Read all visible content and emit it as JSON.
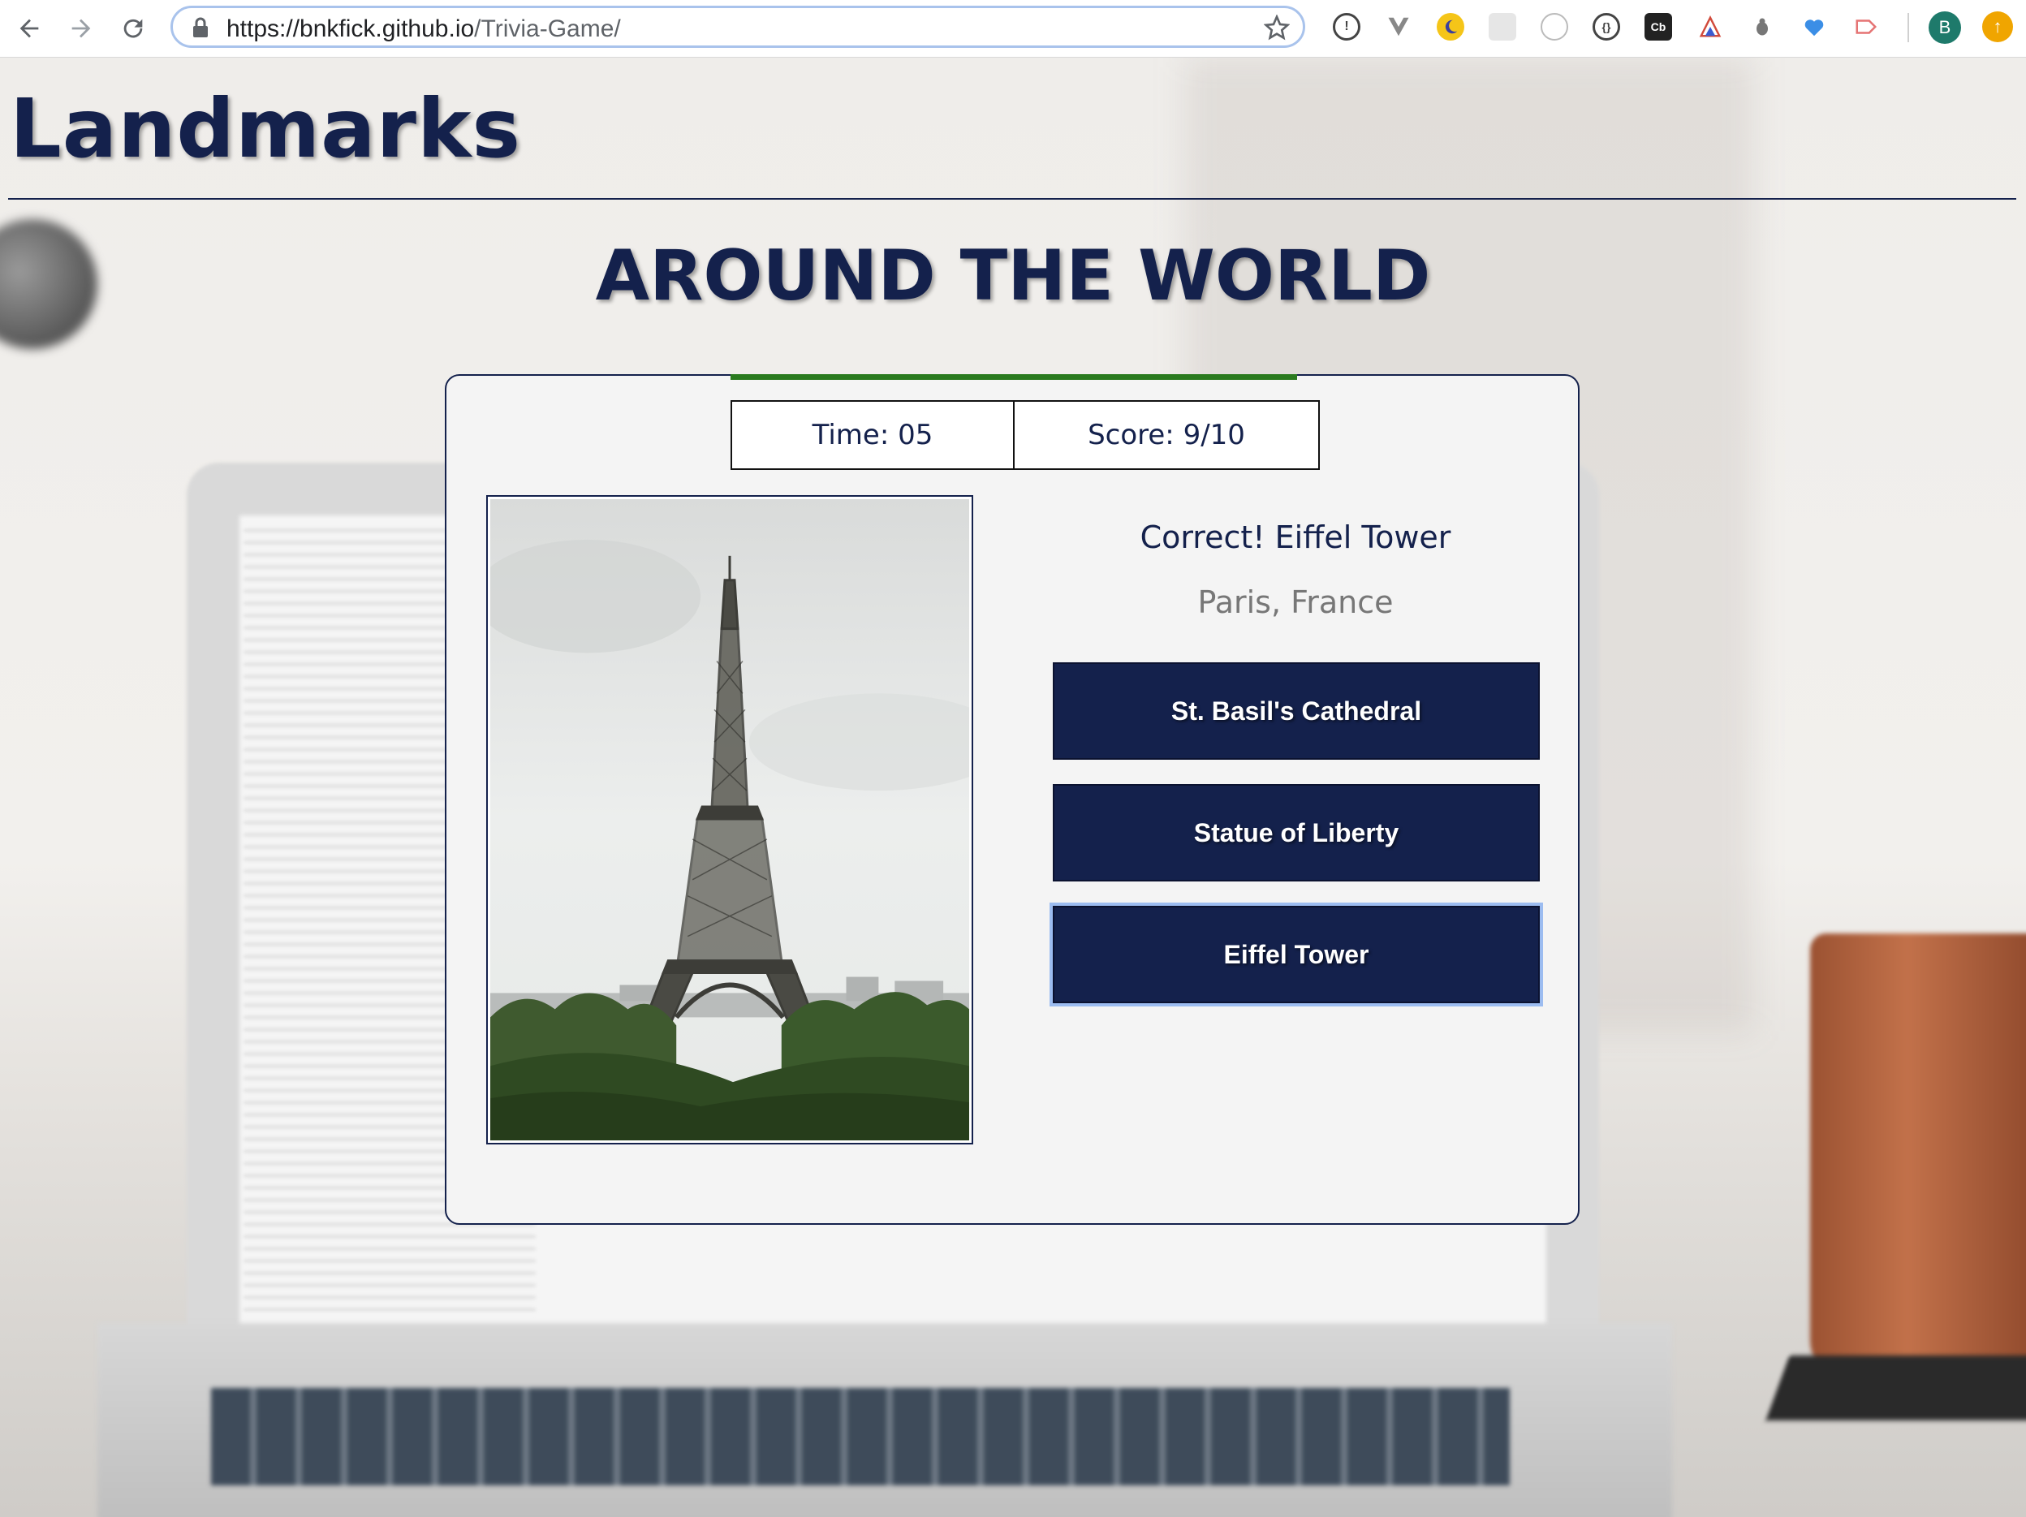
{
  "browser": {
    "url_domain": "https://bnkfick.github.io",
    "url_path": "/Trivia-Game/",
    "avatar_letter": "B"
  },
  "page": {
    "site_title": "Landmarks",
    "subtitle": "AROUND THE WORLD"
  },
  "game": {
    "time_label": "Time: 05",
    "score_label": "Score: 9/10",
    "progress_fraction": 1.0,
    "result_text": "Correct! Eiffel Tower",
    "location_text": "Paris, France",
    "image_subject": "eiffel-tower-photo",
    "answers": [
      {
        "label": "St. Basil's Cathedral"
      },
      {
        "label": "Statue of Liberty"
      },
      {
        "label": "Eiffel Tower"
      }
    ],
    "selected_answer_index": 2
  },
  "colors": {
    "primary": "#14214c",
    "progress": "#2a7a1e",
    "focus_ring": "#9cbcf0"
  }
}
